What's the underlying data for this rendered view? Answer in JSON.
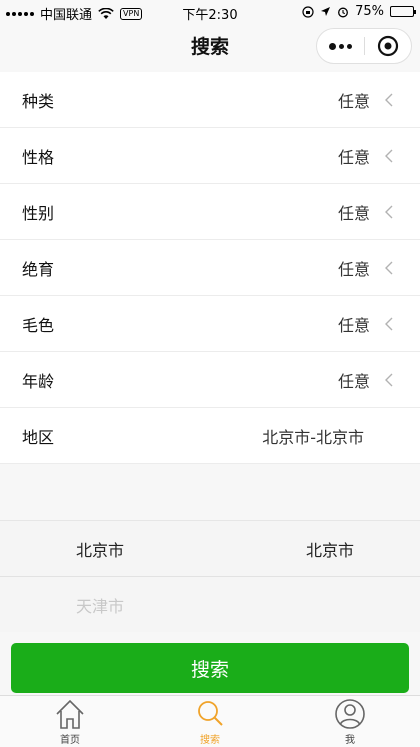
{
  "status_bar": {
    "carrier": "中国联通",
    "vpn": "VPN",
    "time": "下午2:30",
    "battery": "75%",
    "battery_level": 0.75
  },
  "nav": {
    "title": "搜索",
    "more_icon": "more-dots-icon",
    "close_icon": "target-circle-icon"
  },
  "form": {
    "rows": [
      {
        "label": "种类",
        "value": "任意"
      },
      {
        "label": "性格",
        "value": "任意"
      },
      {
        "label": "性别",
        "value": "任意"
      },
      {
        "label": "绝育",
        "value": "任意"
      },
      {
        "label": "毛色",
        "value": "任意"
      },
      {
        "label": "年龄",
        "value": "任意"
      }
    ],
    "region": {
      "label": "地区",
      "value": "北京市-北京市"
    }
  },
  "picker": {
    "selected": {
      "province": "北京市",
      "city": "北京市"
    },
    "next": {
      "province": "天津市"
    }
  },
  "search_button": {
    "label": "搜索"
  },
  "tab_bar": {
    "tabs": [
      {
        "label": "首页",
        "icon": "home-icon",
        "active": false
      },
      {
        "label": "搜索",
        "icon": "search-icon",
        "active": true
      },
      {
        "label": "我",
        "icon": "user-icon",
        "active": false
      }
    ]
  },
  "colors": {
    "primary_green": "#1aad19",
    "tab_active": "#f0a32a"
  }
}
